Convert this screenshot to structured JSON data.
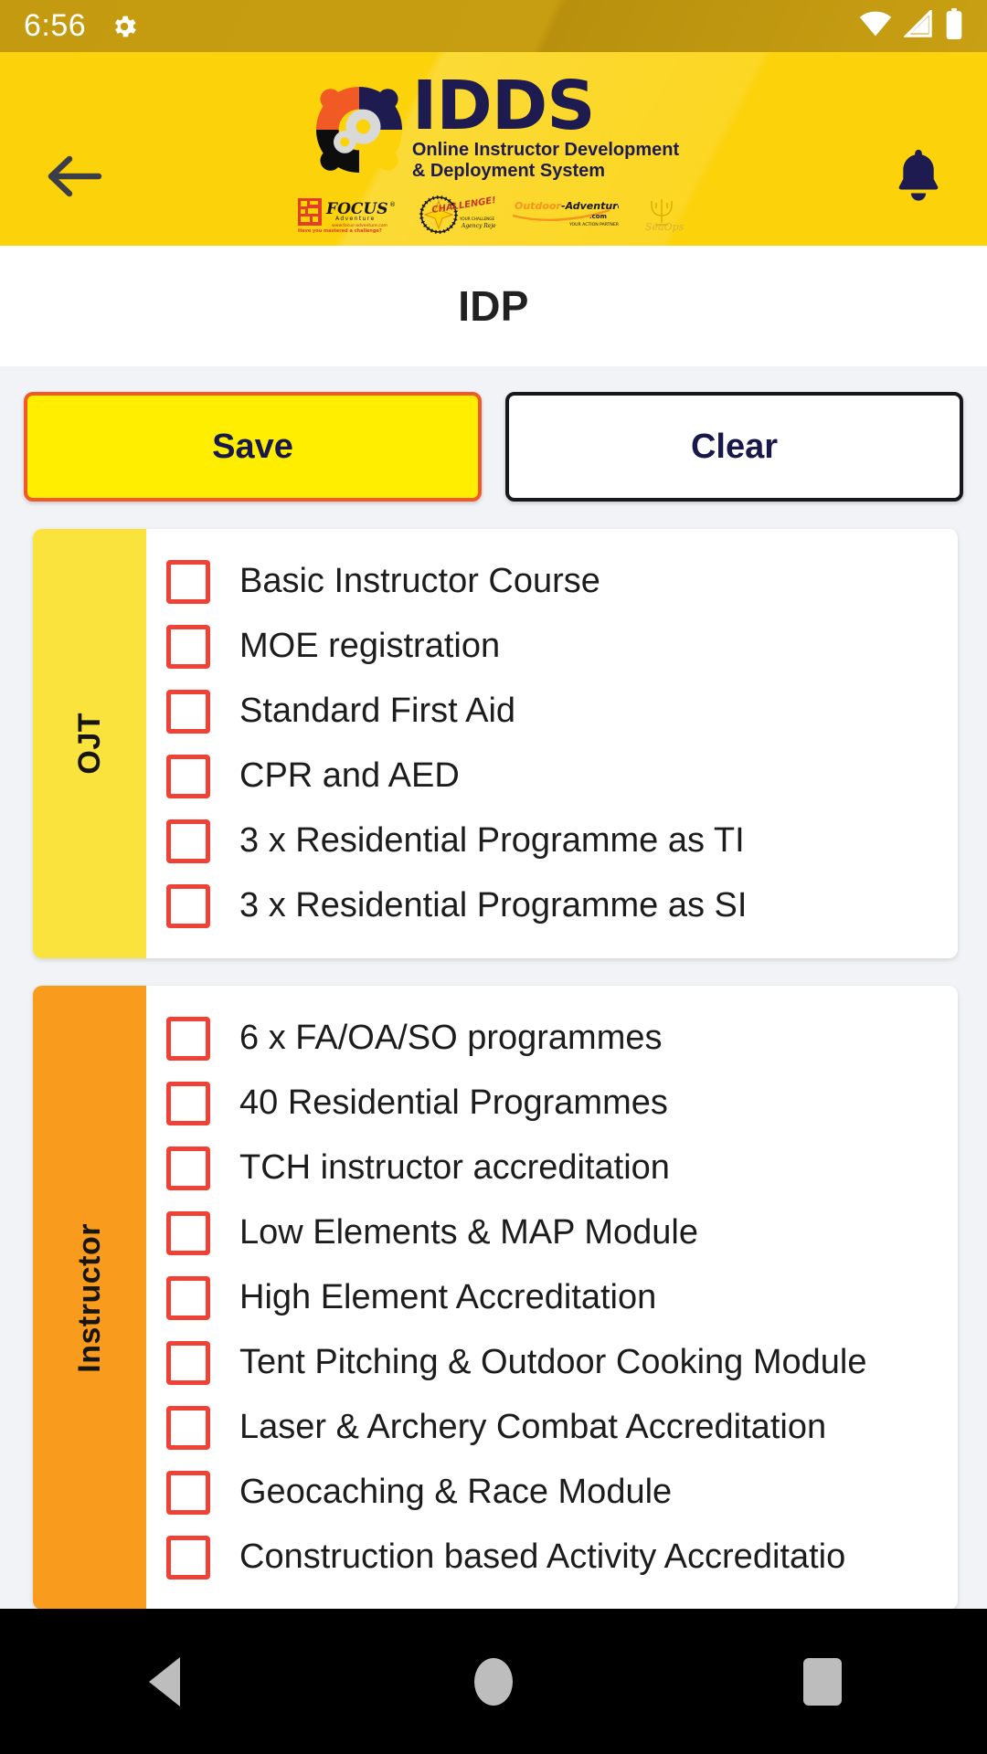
{
  "status_bar": {
    "time": "6:56",
    "icons": [
      "gear-icon",
      "wifi-icon",
      "signal-icon",
      "battery-icon"
    ]
  },
  "header": {
    "back_icon": "back-arrow-icon",
    "notification_icon": "bell-icon",
    "brand_title": "IDDS",
    "brand_subtitle_line1": "Online Instructor Development",
    "brand_subtitle_line2": "& Deployment System",
    "partners": [
      {
        "name": "FOCUS Adventure",
        "main": "FOCUS",
        "sub": "Adventure",
        "tag": "Have you mastered a challenge?"
      },
      {
        "name": "Challenge",
        "main": "CHALLENGE!",
        "sub": "",
        "tag": ""
      },
      {
        "name": "Outdoor-Adventures.com",
        "main": "Outdoor-Adventures",
        "sub": ".com",
        "tag": "YOUR ACTION PARTNER"
      },
      {
        "name": "SeaOps",
        "main": "SeaOps",
        "sub": "",
        "tag": ""
      }
    ]
  },
  "page": {
    "title": "IDP"
  },
  "toolbar": {
    "save_label": "Save",
    "clear_label": "Clear"
  },
  "colors": {
    "header_yellow": "#fcd20a",
    "status_gold": "#c79d11",
    "save_fill": "#ffee00",
    "save_border": "#f05a28",
    "clear_border": "#17171c",
    "navy_text": "#19184b",
    "band_ojt": "#fbe33e",
    "band_instructor": "#f99b1c",
    "checkbox_border": "#ef4136",
    "page_bg": "#f2f3f7"
  },
  "sections": [
    {
      "label": "OJT",
      "band_color": "#fbe33e",
      "items": [
        {
          "label": "Basic Instructor Course",
          "checked": false
        },
        {
          "label": "MOE registration",
          "checked": false
        },
        {
          "label": "Standard First Aid",
          "checked": false
        },
        {
          "label": "CPR and AED",
          "checked": false
        },
        {
          "label": "3 x Residential Programme as TI",
          "checked": false
        },
        {
          "label": "3 x Residential Programme as SI",
          "checked": false
        }
      ]
    },
    {
      "label": "Instructor",
      "band_color": "#f99b1c",
      "items": [
        {
          "label": "6 x FA/OA/SO programmes",
          "checked": false
        },
        {
          "label": "40 Residential Programmes",
          "checked": false
        },
        {
          "label": "TCH instructor accreditation",
          "checked": false
        },
        {
          "label": "Low Elements & MAP Module",
          "checked": false
        },
        {
          "label": "High Element Accreditation",
          "checked": false
        },
        {
          "label": "Tent Pitching & Outdoor Cooking Module",
          "checked": false
        },
        {
          "label": "Laser & Archery Combat Accreditation",
          "checked": false
        },
        {
          "label": "Geocaching & Race Module",
          "checked": false
        },
        {
          "label": "Construction based Activity Accreditatio",
          "checked": false
        }
      ]
    }
  ],
  "navbar": {
    "back_label": "back-triangle-icon",
    "home_label": "home-circle-icon",
    "recents_label": "recents-square-icon"
  }
}
